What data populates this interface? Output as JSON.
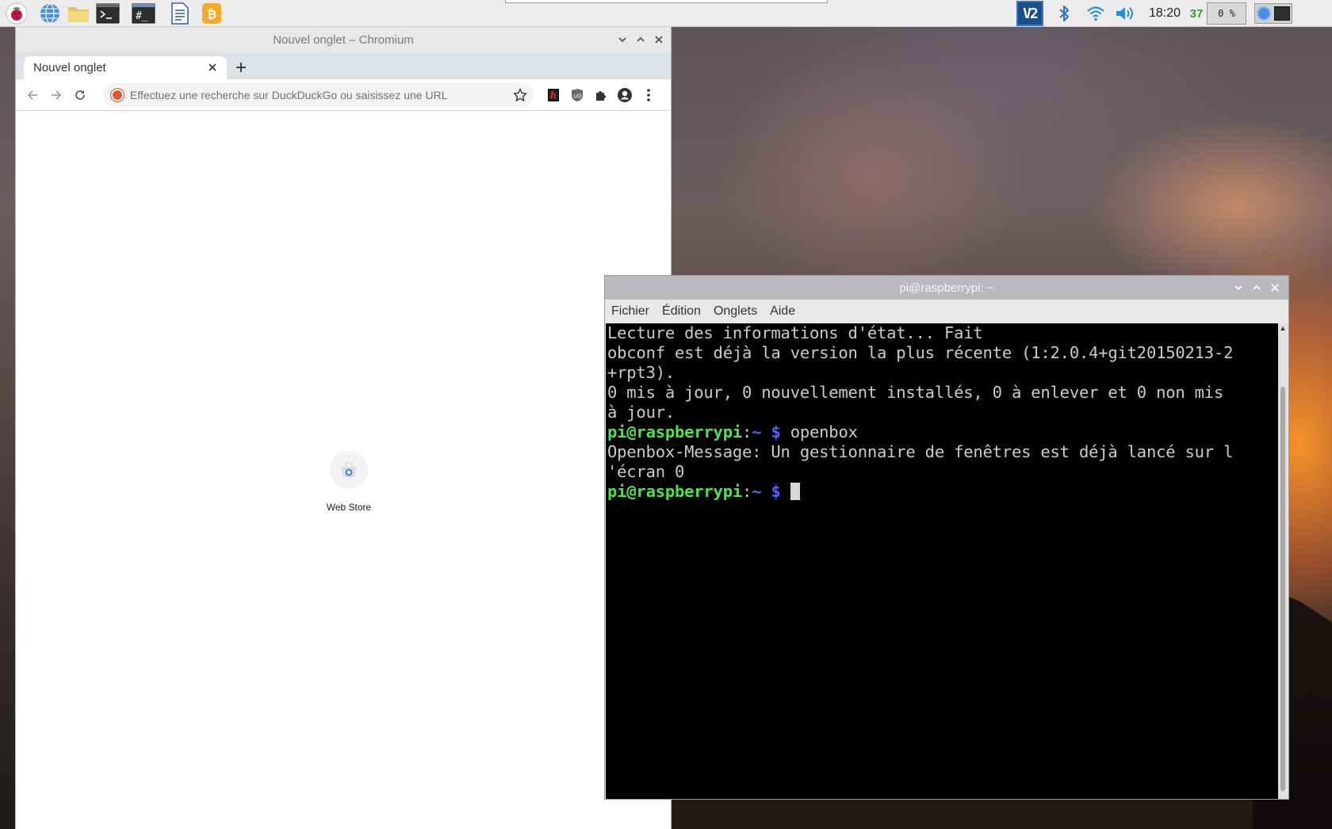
{
  "taskbar": {
    "launchers": [
      {
        "name": "raspberry-menu-icon"
      },
      {
        "name": "web-browser-icon"
      },
      {
        "name": "file-manager-icon"
      },
      {
        "name": "terminal-icon"
      },
      {
        "name": "root-terminal-icon"
      },
      {
        "name": "text-editor-icon"
      },
      {
        "name": "bitcoin-app-icon"
      }
    ],
    "tray": {
      "vnc_label": "V2",
      "clock": "18:20",
      "cpu_temp": "37",
      "cpu_usage": "0 %"
    },
    "colors": {
      "temp": "#2ca02c",
      "vnc_bg": "#1b4f8a"
    }
  },
  "chromium": {
    "window_title": "Nouvel onglet – Chromium",
    "tab_title": "Nouvel onglet",
    "omnibox_placeholder": "Effectuez une recherche sur DuckDuckGo ou saisissez une URL",
    "shortcut_label": "Web Store",
    "controls": [
      "minimize",
      "maximize",
      "close"
    ]
  },
  "terminal": {
    "window_title": "pi@raspberrypi: ~",
    "menu": [
      "Fichier",
      "Édition",
      "Onglets",
      "Aide"
    ],
    "lines": {
      "l1": "Lecture des informations d'état... Fait",
      "l2": "obconf est déjà la version la plus récente (1:2.0.4+git20150213-2",
      "l3": "+rpt3).",
      "l4": "0 mis à jour, 0 nouvellement installés, 0 à enlever et 0 non mis",
      "l5": "à jour.",
      "prompt_user": "pi@raspberrypi",
      "prompt_sep": ":",
      "prompt_path": "~ $",
      "cmd1": " openbox",
      "l7": "Openbox-Message: Un gestionnaire de fenêtres est déjà lancé sur l",
      "l8": "'écran 0"
    },
    "colors": {
      "prompt_user": "#4ce34c",
      "prompt_path": "#5b61ff",
      "text": "#cbcbcb",
      "bg": "#000000"
    }
  }
}
